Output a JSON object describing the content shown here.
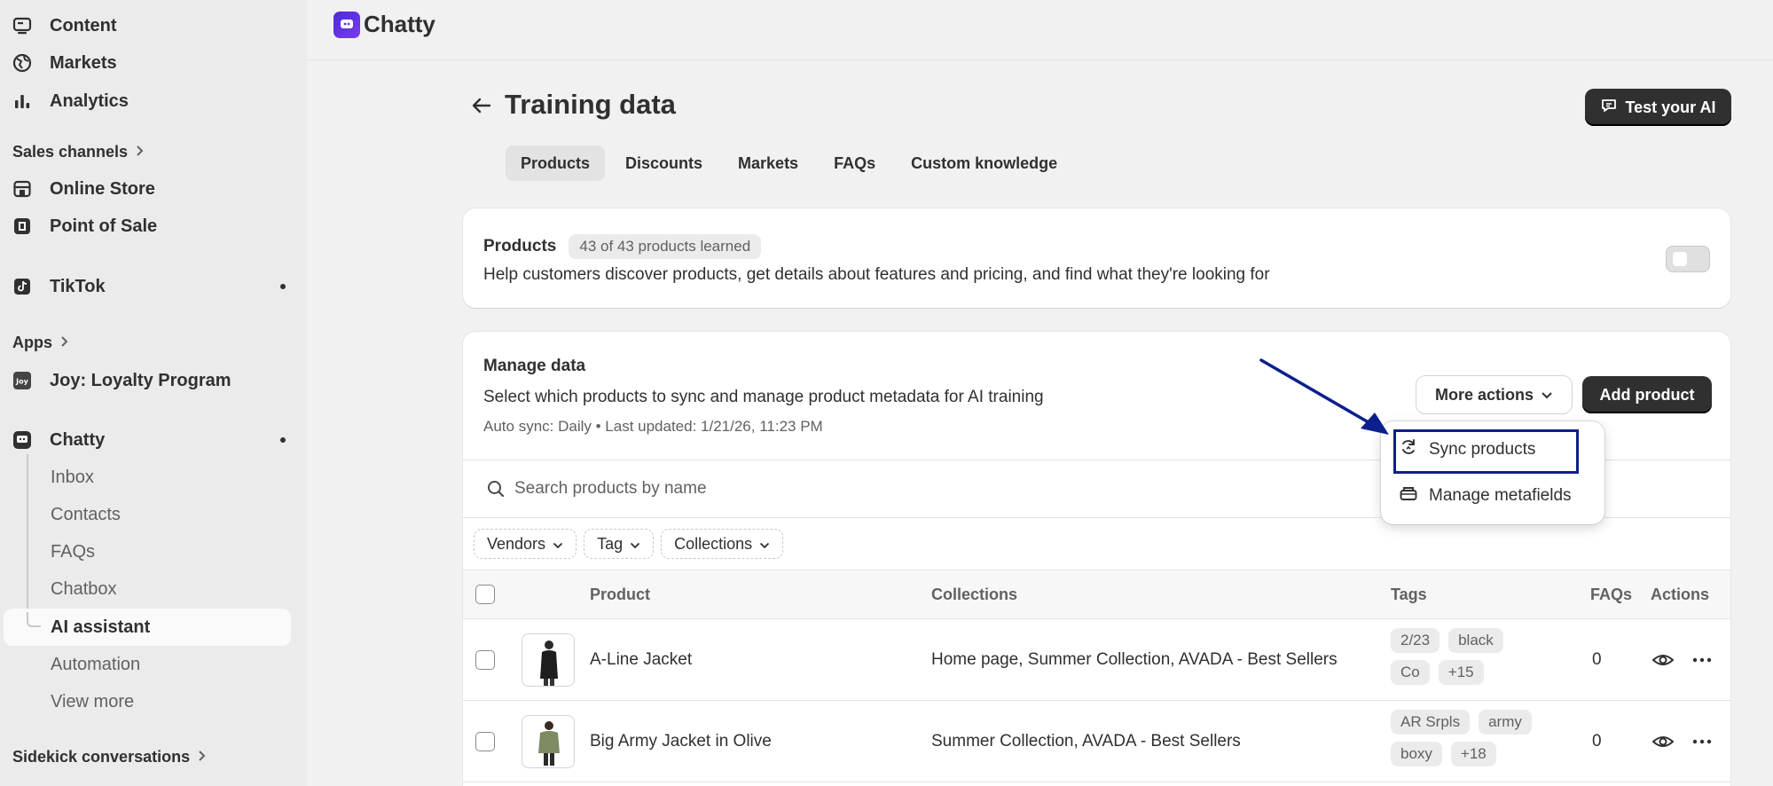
{
  "sidebar": {
    "items": [
      {
        "label": "Content",
        "icon": "content-icon"
      },
      {
        "label": "Markets",
        "icon": "globe-icon"
      },
      {
        "label": "Analytics",
        "icon": "bar-chart-icon"
      }
    ],
    "sales_channels_label": "Sales channels",
    "channels": [
      {
        "label": "Online Store",
        "icon": "store-icon"
      },
      {
        "label": "Point of Sale",
        "icon": "pos-icon"
      }
    ],
    "tiktok_label": "TikTok",
    "apps_label": "Apps",
    "joy_label": "Joy: Loyalty Program",
    "joy_icon_text": "Joy",
    "chatty_label": "Chatty",
    "chatty_sub": [
      "Inbox",
      "Contacts",
      "FAQs",
      "Chatbox",
      "AI assistant",
      "Automation",
      "View more"
    ],
    "sidekick_label": "Sidekick conversations"
  },
  "topbar": {
    "brand": "Chatty"
  },
  "page": {
    "title": "Training data",
    "test_button": "Test your AI",
    "tabs": [
      "Products",
      "Discounts",
      "Markets",
      "FAQs",
      "Custom knowledge"
    ]
  },
  "products_card": {
    "title": "Products",
    "badge": "43 of 43 products learned",
    "description": "Help customers discover products, get details about features and pricing, and find what they're looking for"
  },
  "manage_card": {
    "title": "Manage data",
    "description": "Select which products to sync and manage product metadata for AI training",
    "meta": "Auto sync: Daily • Last updated: 1/21/26, 11:23 PM",
    "more_actions": "More actions",
    "add_product": "Add product",
    "search_placeholder": "Search products by name",
    "filters": [
      "Vendors",
      "Tag",
      "Collections"
    ],
    "columns": {
      "product": "Product",
      "collections": "Collections",
      "tags": "Tags",
      "faqs": "FAQs",
      "actions": "Actions"
    },
    "rows": [
      {
        "name": "A-Line Jacket",
        "collections": "Home page, Summer Collection, AVADA - Best Sellers",
        "tags": [
          "2/23",
          "black",
          "Co",
          "+15"
        ],
        "faqs": "0"
      },
      {
        "name": "Big Army Jacket in Olive",
        "collections": "Summer Collection, AVADA - Best Sellers",
        "tags": [
          "AR Srpls",
          "army",
          "boxy",
          "+18"
        ],
        "faqs": "0"
      }
    ]
  },
  "dropdown": {
    "items": [
      {
        "label": "Sync products",
        "icon": "sync-icon"
      },
      {
        "label": "Manage metafields",
        "icon": "metafields-icon"
      }
    ]
  },
  "colors": {
    "primary_button": "#303030",
    "highlight_box": "#0d1f8c",
    "arrow": "#0d1f8c"
  }
}
